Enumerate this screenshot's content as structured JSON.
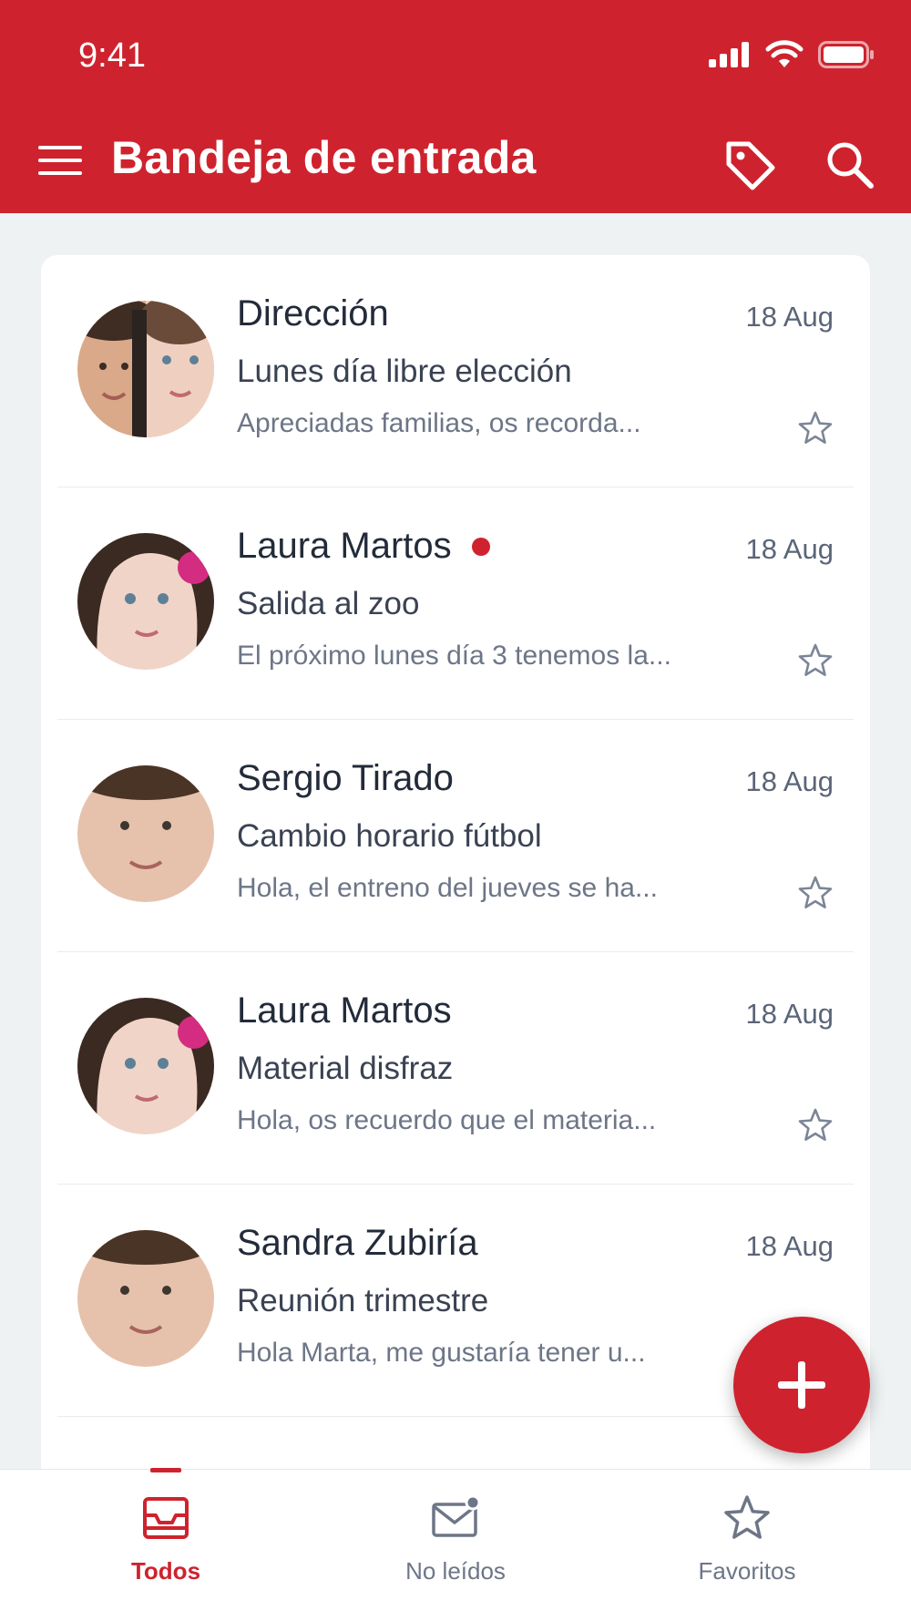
{
  "status_bar": {
    "time": "9:41"
  },
  "header": {
    "title": "Bandeja de entrada"
  },
  "messages": [
    {
      "sender": "Dirección",
      "date": "18 Aug",
      "subject": "Lunes día libre elección",
      "preview": "Apreciadas familias, os recorda...",
      "unread": false
    },
    {
      "sender": "Laura Martos",
      "date": "18 Aug",
      "subject": "Salida al zoo",
      "preview": "El próximo lunes día 3 tenemos la...",
      "unread": true
    },
    {
      "sender": "Sergio Tirado",
      "date": "18 Aug",
      "subject": "Cambio horario fútbol",
      "preview": "Hola, el entreno del jueves se ha...",
      "unread": false
    },
    {
      "sender": "Laura Martos",
      "date": "18 Aug",
      "subject": "Material disfraz",
      "preview": "Hola, os recuerdo que el materia...",
      "unread": false
    },
    {
      "sender": "Sandra Zubiría",
      "date": "18 Aug",
      "subject": "Reunión trimestre",
      "preview": "Hola Marta, me gustaría tener u...",
      "unread": false
    }
  ],
  "bottom_nav": {
    "items": [
      {
        "label": "Todos",
        "icon": "inbox-icon",
        "active": true
      },
      {
        "label": "No leídos",
        "icon": "unread-mail-icon",
        "active": false
      },
      {
        "label": "Favoritos",
        "icon": "star-icon",
        "active": false
      }
    ]
  },
  "colors": {
    "accent": "#ce232e",
    "background": "#eef2f2",
    "card": "#ffffff"
  }
}
